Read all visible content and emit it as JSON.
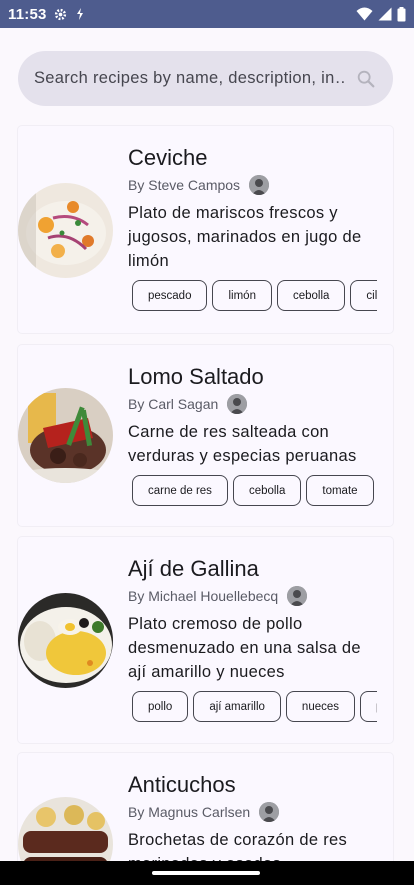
{
  "status_bar": {
    "time": "11:53",
    "left_icons": [
      "settings-icon",
      "sync-icon"
    ],
    "right_icons": [
      "wifi-icon",
      "signal-icon",
      "battery-icon"
    ]
  },
  "search": {
    "placeholder": "Search recipes by name, description, in…",
    "value": "",
    "icon": "search-icon"
  },
  "recipes": [
    {
      "title": "Ceviche",
      "author": "By Steve Campos",
      "description": "Plato de mariscos frescos y jugosos, marinados en jugo de limón",
      "tags": [
        "pescado",
        "limón",
        "cebolla",
        "cilantro"
      ]
    },
    {
      "title": "Lomo Saltado",
      "author": "By Carl Sagan",
      "description": "Carne de res salteada con verduras y especias peruanas",
      "tags": [
        "carne de res",
        "cebolla",
        "tomate"
      ]
    },
    {
      "title": "Ají de Gallina",
      "author": "By Michael Houellebecq",
      "description": "Plato cremoso de pollo desmenuzado en una salsa de ají amarillo y nueces",
      "tags": [
        "pollo",
        "ají amarillo",
        "nueces",
        "pan"
      ]
    },
    {
      "title": "Anticuchos",
      "author": "By Magnus Carlsen",
      "description": "Brochetas de corazón de res marinadas y asadas"
    }
  ],
  "colors": {
    "status_bar": "#4e5c8e",
    "background": "#fbf8fd",
    "search_bg": "#e4e1ec",
    "chip_border": "#46464f"
  }
}
